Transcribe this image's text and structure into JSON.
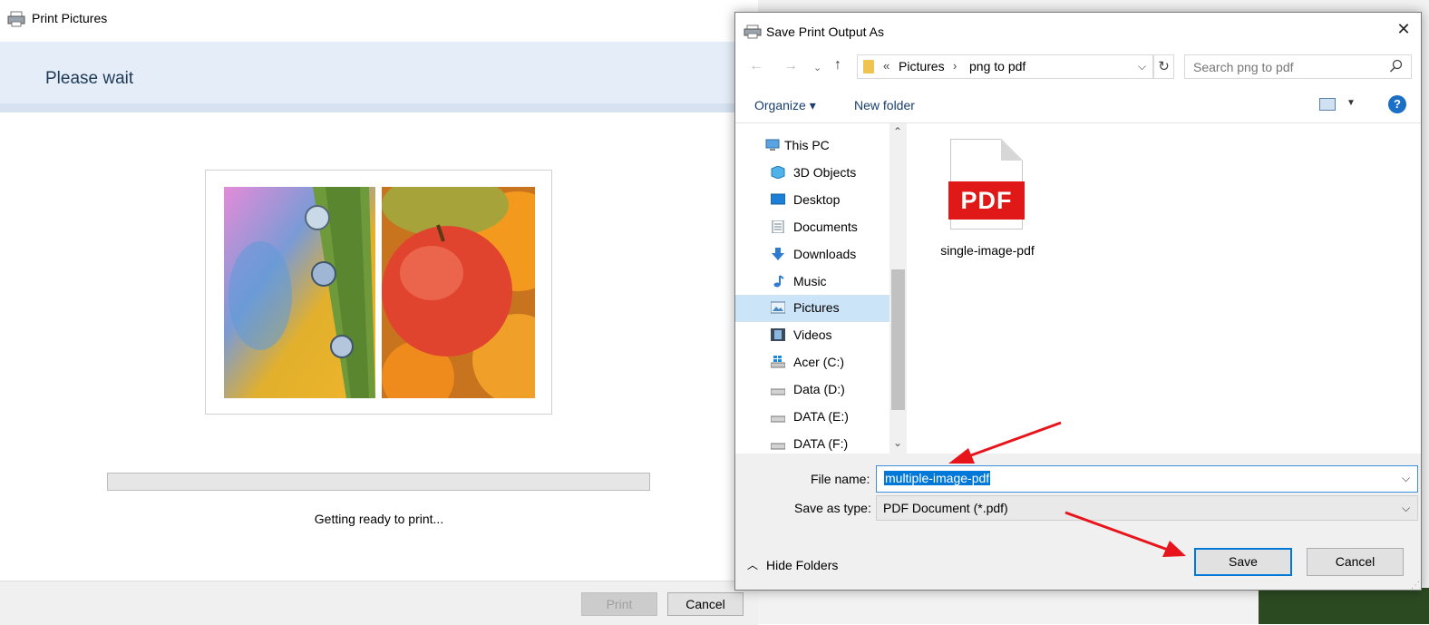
{
  "print_window": {
    "title": "Print Pictures",
    "heading": "Please wait",
    "status": "Getting ready to print...",
    "progress_fraction": 0,
    "buttons": {
      "print": "Print",
      "cancel": "Cancel"
    }
  },
  "dialog": {
    "title": "Save Print Output As",
    "close_glyph": "✕",
    "address": {
      "prefix": "«",
      "crumbs": [
        "Pictures",
        "png to pdf"
      ],
      "separator": "›"
    },
    "search": {
      "placeholder": "Search png to pdf"
    },
    "toolbar": {
      "organize": "Organize ▾",
      "new_folder": "New folder",
      "help": "?"
    },
    "nav_items": [
      {
        "label": "This PC",
        "icon": "computer-icon"
      },
      {
        "label": "3D Objects",
        "icon": "cube-icon"
      },
      {
        "label": "Desktop",
        "icon": "desktop-icon"
      },
      {
        "label": "Documents",
        "icon": "documents-icon"
      },
      {
        "label": "Downloads",
        "icon": "download-arrow-icon"
      },
      {
        "label": "Music",
        "icon": "music-note-icon"
      },
      {
        "label": "Pictures",
        "icon": "pictures-icon",
        "selected": true
      },
      {
        "label": "Videos",
        "icon": "film-icon"
      },
      {
        "label": "Acer (C:)",
        "icon": "windows-drive-icon"
      },
      {
        "label": "Data (D:)",
        "icon": "drive-icon"
      },
      {
        "label": "DATA (E:)",
        "icon": "drive-icon"
      },
      {
        "label": "DATA (F:)",
        "icon": "drive-icon"
      }
    ],
    "files": [
      {
        "name": "single-image-pdf",
        "badge": "PDF",
        "icon": "pdf-file-icon"
      }
    ],
    "form": {
      "file_name_label": "File name:",
      "file_name_value": "multiple-image-pdf",
      "save_type_label": "Save as type:",
      "save_type_value": "PDF Document (*.pdf)"
    },
    "hide_folders": "Hide Folders",
    "buttons": {
      "save": "Save",
      "cancel": "Cancel"
    }
  },
  "colors": {
    "accent": "#0078d7",
    "annotation_arrow": "#e8141c",
    "pdf_badge": "#e01818"
  }
}
